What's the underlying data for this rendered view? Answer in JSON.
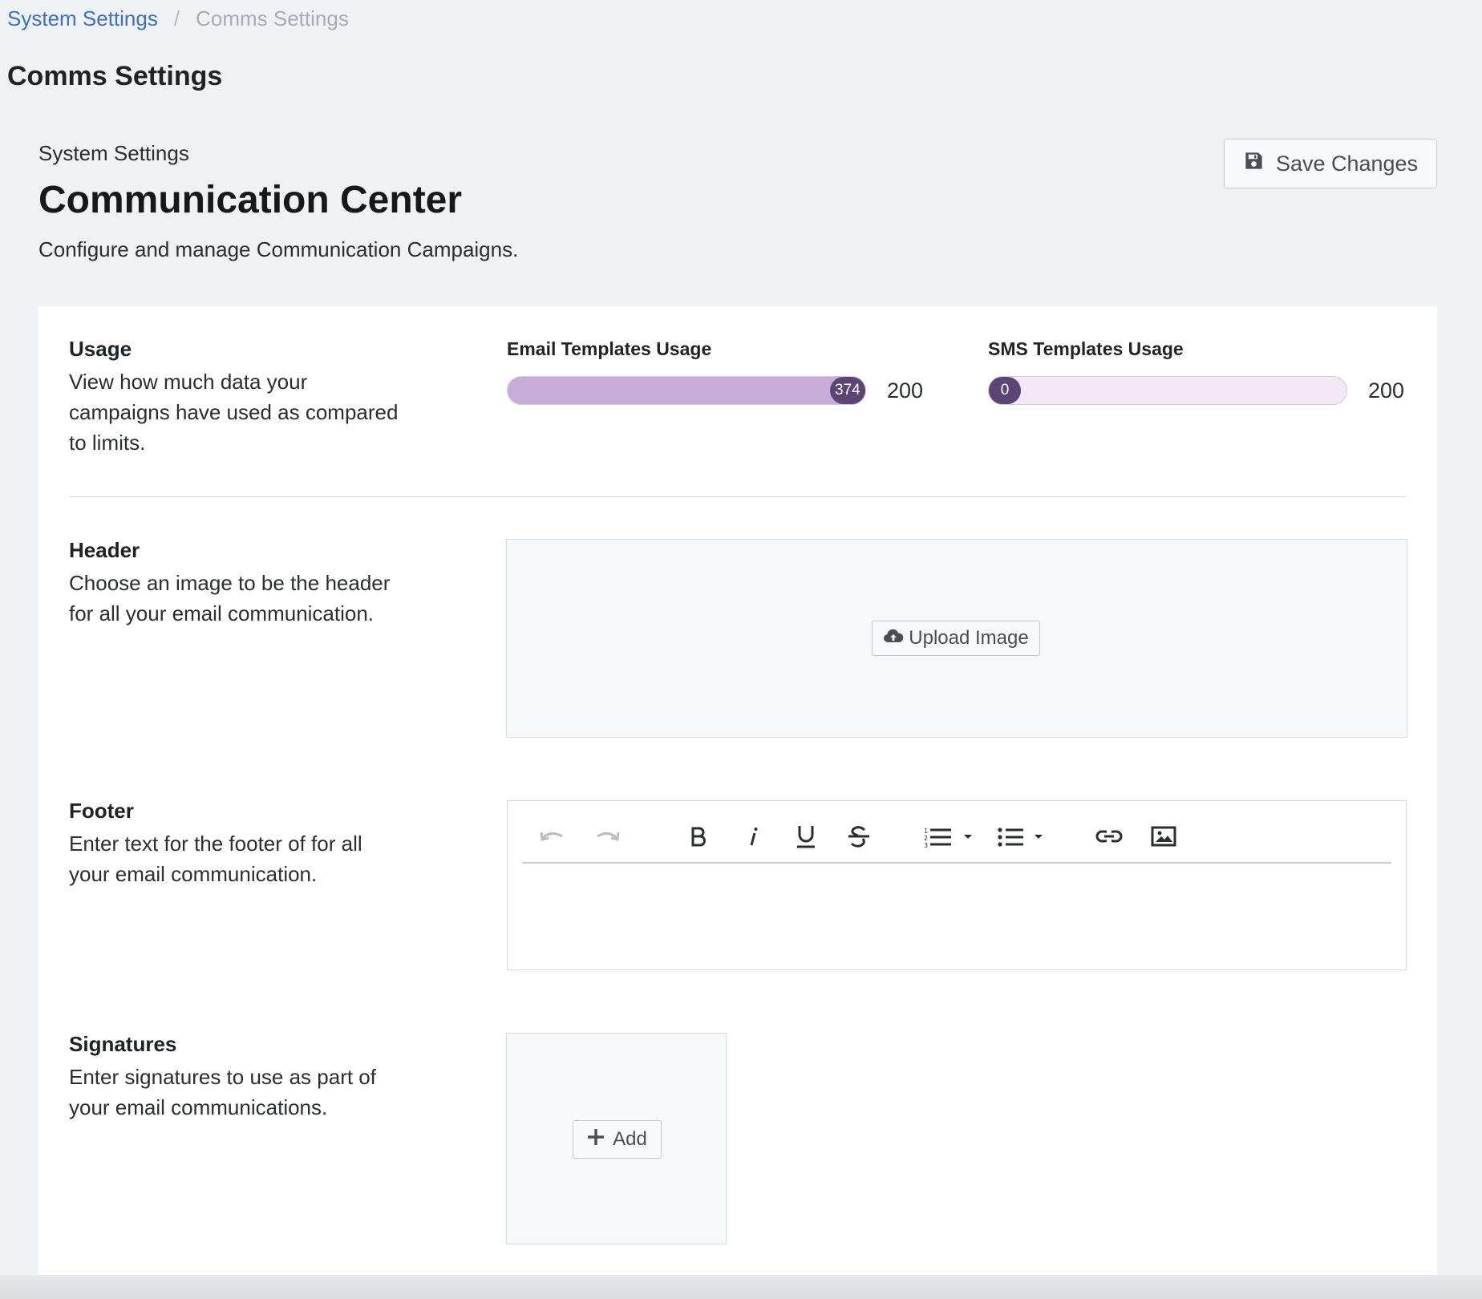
{
  "breadcrumb": {
    "items": [
      "System Settings",
      "Comms Settings"
    ],
    "separator": "/"
  },
  "page_title": "Comms Settings",
  "header": {
    "eyebrow": "System Settings",
    "title": "Communication Center",
    "description": "Configure and manage Communication Campaigns.",
    "save_label": "Save Changes",
    "save_icon": "floppy-disk-icon"
  },
  "usage": {
    "title": "Usage",
    "description": "View how much data your campaigns have used as compared to limits.",
    "email": {
      "label": "Email Templates Usage",
      "value": 374,
      "value_text": "374",
      "limit": "200",
      "fill_fraction": 1.0
    },
    "sms": {
      "label": "SMS Templates Usage",
      "value": 0,
      "value_text": "0",
      "limit": "200",
      "fill_fraction": 0.0
    },
    "colors": {
      "track": "#f1e7f6",
      "fill": "#c8acd8",
      "knob": "#5a4575"
    }
  },
  "header_section": {
    "title": "Header",
    "description": "Choose an image to be the header for all your email communication.",
    "upload_label": "Upload Image",
    "upload_icon": "cloud-upload-icon"
  },
  "footer_section": {
    "title": "Footer",
    "description": "Enter text for the footer of for all your email communication.",
    "toolbar": [
      "undo-icon",
      "redo-icon",
      "bold-icon",
      "italic-icon",
      "underline-icon",
      "strikethrough-icon",
      "ordered-list-icon",
      "bullet-list-icon",
      "link-icon",
      "image-icon"
    ],
    "content": ""
  },
  "signatures_section": {
    "title": "Signatures",
    "description": "Enter signatures to use as part of your email communications.",
    "add_label": "Add",
    "add_icon": "plus-icon"
  }
}
